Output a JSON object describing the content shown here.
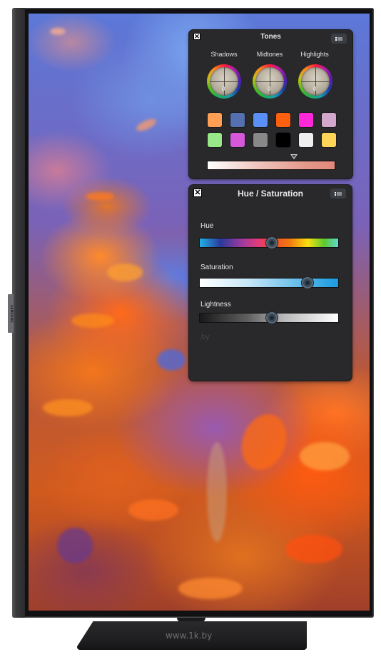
{
  "device": {
    "brand_label": "SAMSUNG",
    "watermark": "www.1k.by"
  },
  "tones_panel": {
    "title": "Tones",
    "close_icon": "close-x-icon",
    "menu_icon": "panel-menu-icon",
    "wheels": [
      {
        "label": "Shadows",
        "value": "0"
      },
      {
        "label": "Midtones",
        "value": "0"
      },
      {
        "label": "Highlights",
        "value": "0"
      }
    ],
    "swatches": [
      {
        "name": "orange",
        "color": "#ff9f55"
      },
      {
        "name": "slate-blue",
        "color": "#5570b0"
      },
      {
        "name": "blue",
        "color": "#5a8ff5"
      },
      {
        "name": "deep-orange",
        "color": "#ff6010"
      },
      {
        "name": "magenta",
        "color": "#ff28d8"
      },
      {
        "name": "lilac",
        "color": "#d4a8cc"
      },
      {
        "name": "light-green",
        "color": "#98e88a"
      },
      {
        "name": "purple",
        "color": "#d458d8"
      },
      {
        "name": "gray",
        "color": "#888888"
      },
      {
        "name": "black",
        "color": "#000000"
      },
      {
        "name": "white",
        "color": "#efefef"
      },
      {
        "name": "yellow",
        "color": "#ffd458"
      }
    ],
    "tone_bar": {
      "marker_position": 0.68,
      "start_color": "#ffffff",
      "end_color": "#e0887a"
    }
  },
  "hue_panel": {
    "title": "Hue / Saturation",
    "close_icon": "close-x-icon",
    "menu_icon": "panel-menu-icon",
    "sliders": [
      {
        "label": "Hue",
        "value": 0.52
      },
      {
        "label": "Saturation",
        "value": 0.78
      },
      {
        "label": "Lightness",
        "value": 0.52
      }
    ],
    "ghost_text": ".by"
  }
}
